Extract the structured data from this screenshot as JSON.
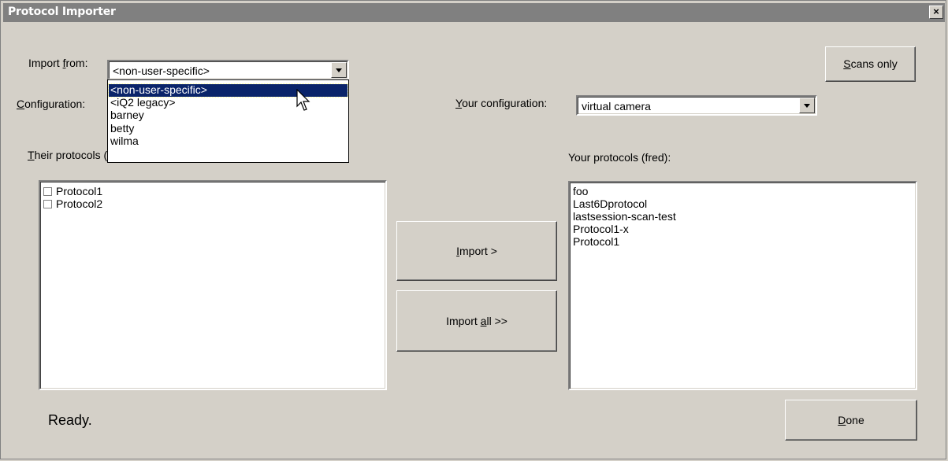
{
  "window": {
    "title": "Protocol Importer",
    "close_glyph": "×"
  },
  "import_from": {
    "label_pre": "Import ",
    "label_key": "f",
    "label_post": "rom:",
    "value": "<non-user-specific>",
    "options": [
      "<non-user-specific>",
      "<iQ2 legacy>",
      "barney",
      "betty",
      "wilma"
    ],
    "selected_index": 0
  },
  "configuration": {
    "label_key": "C",
    "label_post": "onfiguration:"
  },
  "your_configuration": {
    "label_key": "Y",
    "label_post": "our configuration:",
    "value": "virtual camera"
  },
  "scans_only": {
    "label_key": "S",
    "label_post": "cans only"
  },
  "their_protocols": {
    "label_key": "T",
    "label_post": "heir protocols (non-user-specific):",
    "items": [
      "Protocol1",
      "Protocol2"
    ]
  },
  "your_protocols": {
    "label": "Your protocols (fred):",
    "items": [
      "foo",
      "Last6Dprotocol",
      "lastsession-scan-test",
      "Protocol1-x",
      "Protocol1"
    ]
  },
  "import_button": {
    "label_key": "I",
    "label_post": "mport >"
  },
  "import_all_button": {
    "label_pre": "Import ",
    "label_key": "a",
    "label_post": "ll >>"
  },
  "done_button": {
    "label_key": "D",
    "label_post": "one"
  },
  "status": "Ready.",
  "icons": {
    "cursor": "mouse-pointer-icon"
  },
  "colors": {
    "selection": "#0a246a",
    "face": "#d4d0c8",
    "title_bar": "#808080"
  }
}
